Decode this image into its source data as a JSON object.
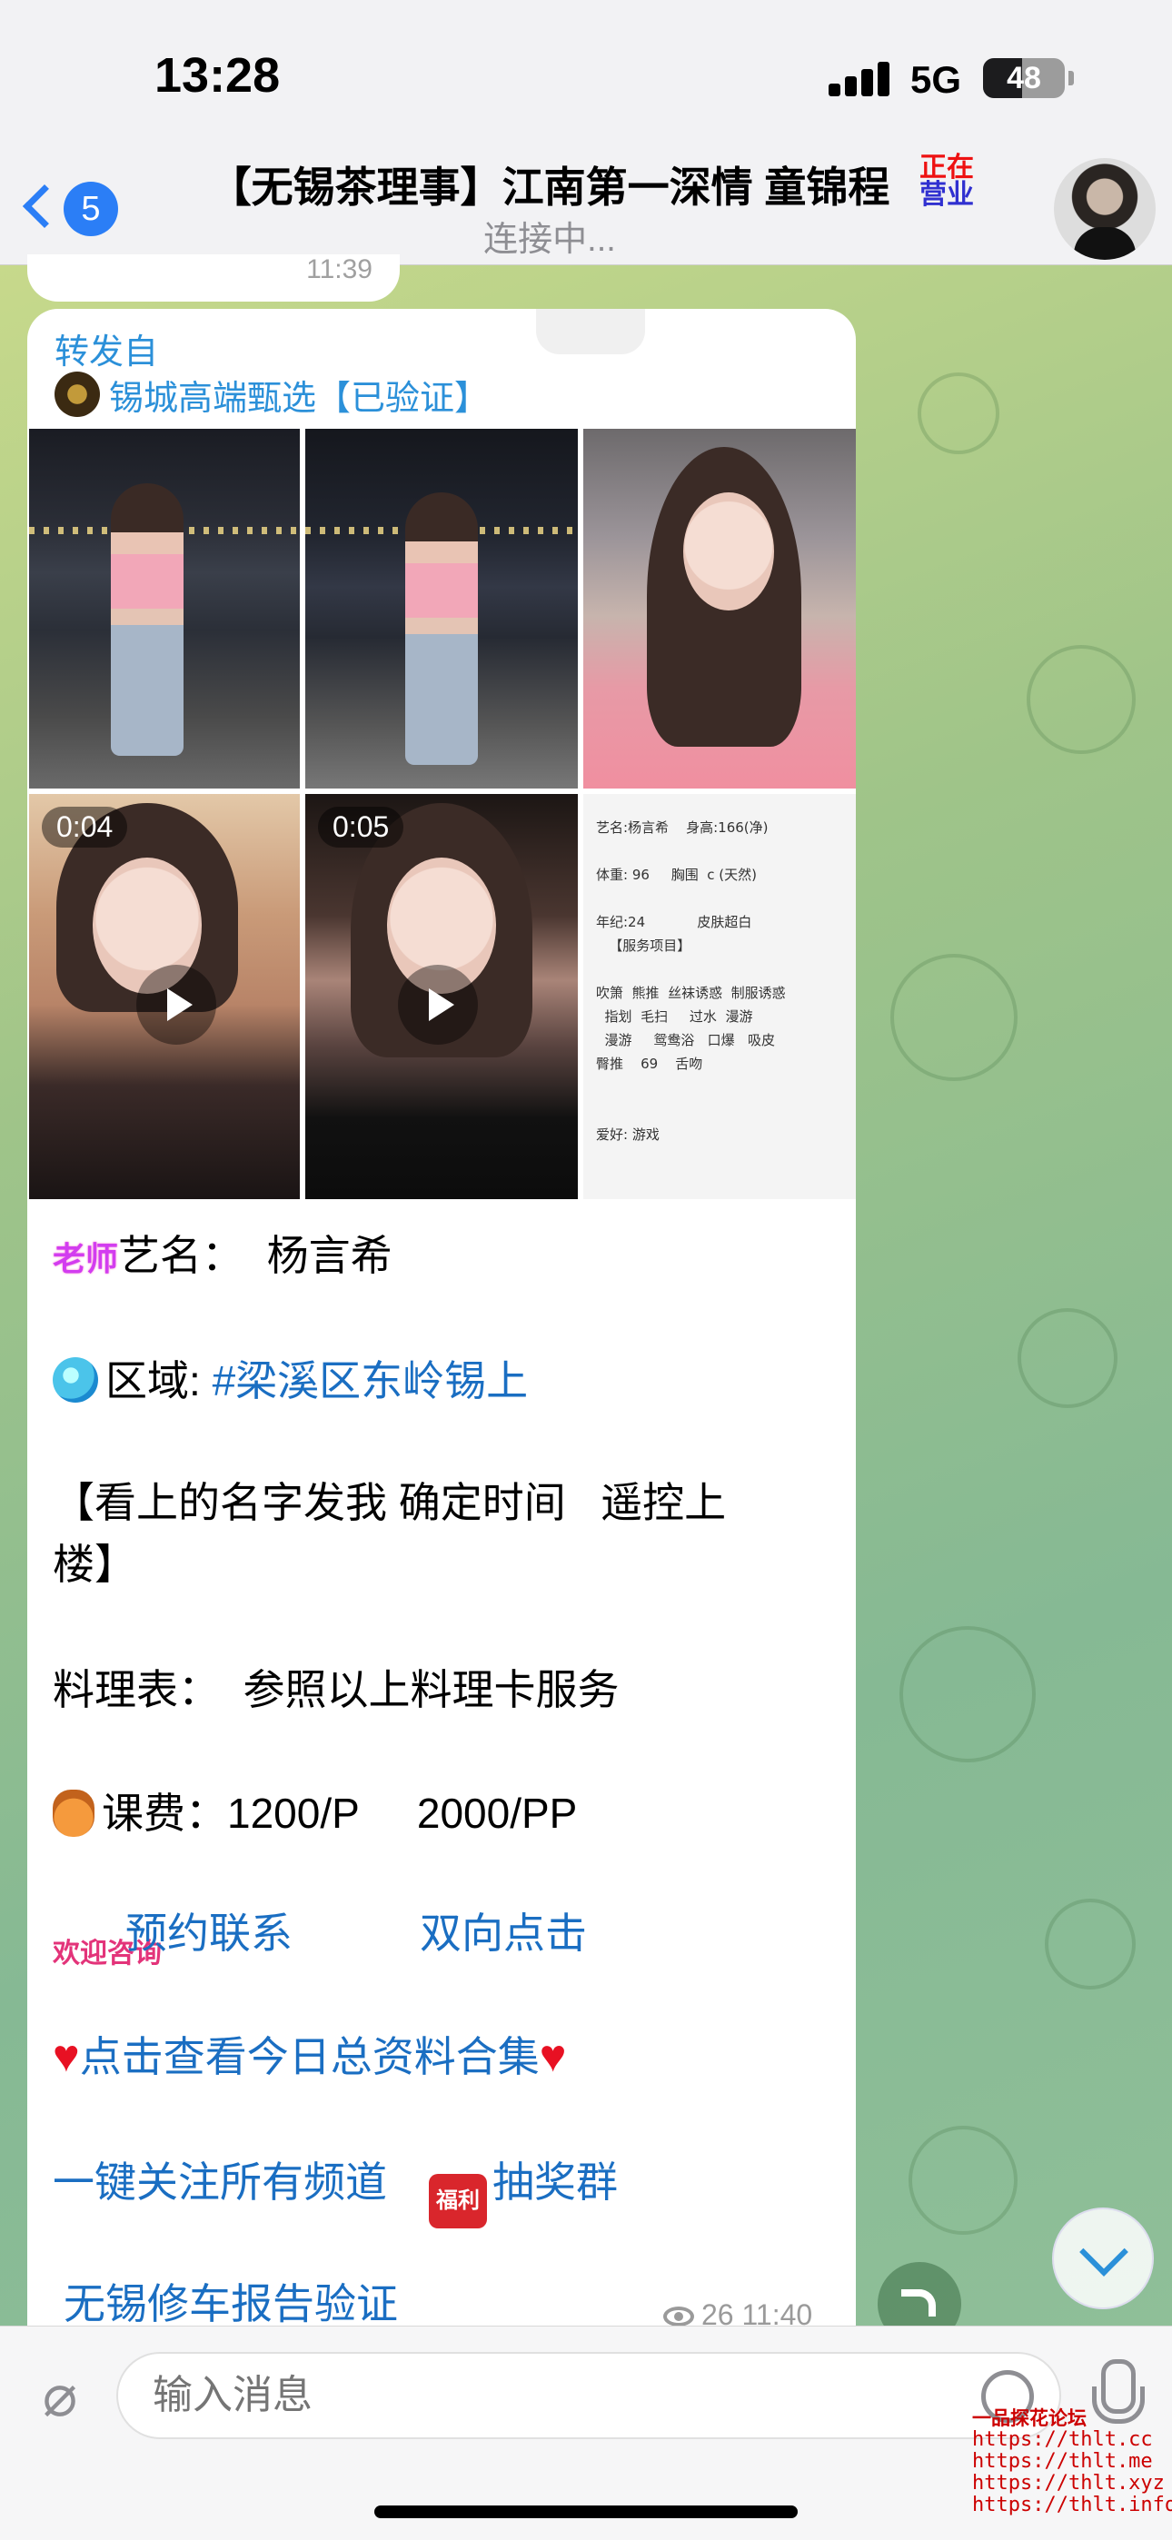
{
  "status_bar": {
    "time": "13:28",
    "network": "5G",
    "battery": "48",
    "battery_level": 0.48
  },
  "header": {
    "back_count": "5",
    "title": "【无锡茶理事】江南第一深情 童锦程",
    "open_badge_top": "正在",
    "open_badge_bottom": "营业",
    "subtitle": "连接中..."
  },
  "prev_message": {
    "time": "11:39"
  },
  "message": {
    "forwarded_label": "转发自",
    "source_name": "锡城高端甄选【已验证】",
    "videos": [
      {
        "duration": "0:04"
      },
      {
        "duration": "0:05"
      }
    ],
    "profile_card": {
      "line1": "艺名:杨言希    身高:166(净)",
      "line2": "体重: 96     胸围  c (天然)",
      "line3": "年纪:24            皮肤超白",
      "line4": "   【服务项目】",
      "line5": "吹箫  熊推  丝袜诱惑  制服诱惑",
      "line6": "  指划  毛扫     过水  漫游",
      "line7": "  漫游     鸳鸯浴   口爆   吸皮",
      "line8": "臀推    69    舌吻",
      "line9": "爱好: 游戏"
    },
    "teacher_tag": "老师",
    "stage_name": "艺名：  杨言希",
    "region_label": "区域: ",
    "region_link": "#梁溪区东岭锡上",
    "instruction_1": "【看上的名字发我 确定时间   遥控上",
    "instruction_2": "楼】",
    "menu": "料理表：  参照以上料理卡服务",
    "fee": "课费：1200/P     2000/PP",
    "welcome_icon": "欢迎咨询",
    "book_link": "预约联系",
    "two_way_link": "双向点击",
    "collection_link": "点击查看今日总资料合集",
    "follow_link": "一键关注所有频道",
    "gift_icon": "福利",
    "lottery_link": "抽奖群",
    "repair_link": "无锡修车报告验证",
    "views": "26",
    "time": "11:40"
  },
  "input": {
    "placeholder": "输入消息"
  },
  "watermark": {
    "title": "一品探花论坛",
    "urls": [
      "https://thlt.cc",
      "https://thlt.me",
      "https://thlt.xyz",
      "https://thlt.info"
    ]
  }
}
